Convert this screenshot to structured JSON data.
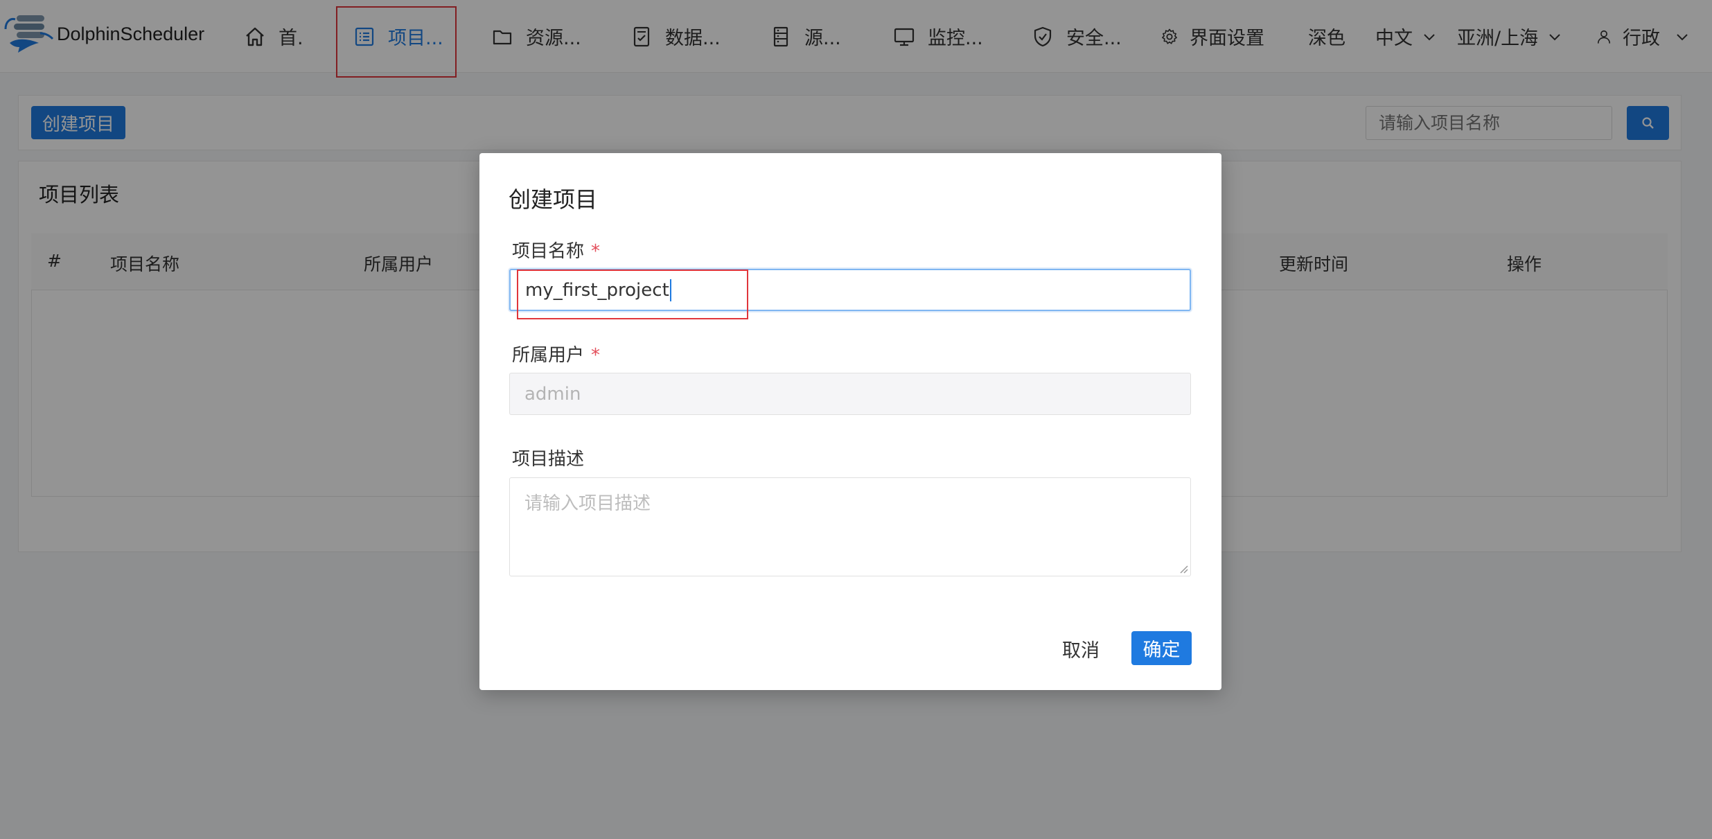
{
  "header": {
    "brand": "DolphinScheduler",
    "nav": [
      {
        "label": "首.",
        "icon": "home-icon"
      },
      {
        "label": "项目...",
        "icon": "list-icon",
        "active": true
      },
      {
        "label": "资源...",
        "icon": "folder-icon"
      },
      {
        "label": "数据...",
        "icon": "data-icon"
      },
      {
        "label": "源...",
        "icon": "server-icon"
      },
      {
        "label": "监控...",
        "icon": "monitor-icon"
      },
      {
        "label": "安全...",
        "icon": "shield-icon"
      },
      {
        "label": "界面设置",
        "icon": "gear-icon"
      }
    ],
    "theme": "深色",
    "language": "中文",
    "timezone": "亚洲/上海",
    "user": "行政"
  },
  "toolbar": {
    "create_label": "创建项目",
    "search_placeholder": "请输入项目名称"
  },
  "list": {
    "title": "项目列表",
    "columns": [
      "#",
      "项目名称",
      "所属用户",
      "更新时间",
      "操作"
    ]
  },
  "modal": {
    "title": "创建项目",
    "name_label": "项目名称",
    "name_value": "my_first_project",
    "owner_label": "所属用户",
    "owner_value": "admin",
    "desc_label": "项目描述",
    "desc_placeholder": "请输入项目描述",
    "cancel_label": "取消",
    "confirm_label": "确定",
    "required_mark": "*"
  },
  "colors": {
    "primary": "#1f7ae0",
    "highlight": "#e0353b",
    "required": "#e34d59"
  }
}
